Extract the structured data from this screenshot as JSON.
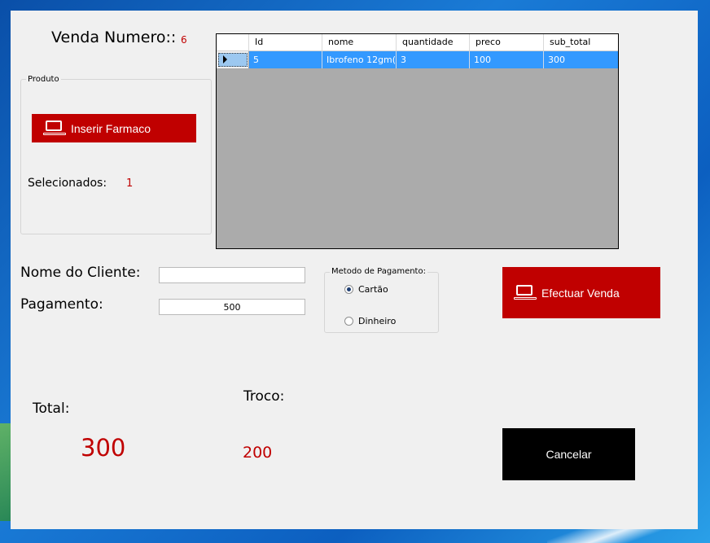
{
  "venda": {
    "label": "Venda Numero::",
    "number": "6"
  },
  "produto": {
    "group_title": "Produto",
    "insert_label": "Inserir Farmaco",
    "selecionados_label": "Selecionados:",
    "selecionados_value": "1"
  },
  "grid": {
    "columns": [
      "Id",
      "nome",
      "quantidade",
      "preco",
      "sub_total"
    ],
    "rows": [
      {
        "id": "5",
        "nome": "Ibrofeno 12gm(...",
        "quantidade": "3",
        "preco": "100",
        "sub_total": "300"
      }
    ]
  },
  "cliente": {
    "label": "Nome do Cliente:",
    "value": ""
  },
  "pagamento": {
    "label": "Pagamento:",
    "value": "500"
  },
  "metodo": {
    "title": "Metodo de Pagamento:",
    "options": [
      {
        "label": "Cartão",
        "selected": true
      },
      {
        "label": "Dinheiro",
        "selected": false
      }
    ]
  },
  "efectuar_label": "Efectuar Venda",
  "total": {
    "label": "Total:",
    "value": "300"
  },
  "troco": {
    "label": "Troco:",
    "value": "200"
  },
  "cancelar_label": "Cancelar",
  "colors": {
    "accent_red": "#c00000",
    "grid_selection": "#3399ff",
    "grid_bg": "#ababab"
  },
  "icons": {
    "laptop": "laptop-icon"
  }
}
